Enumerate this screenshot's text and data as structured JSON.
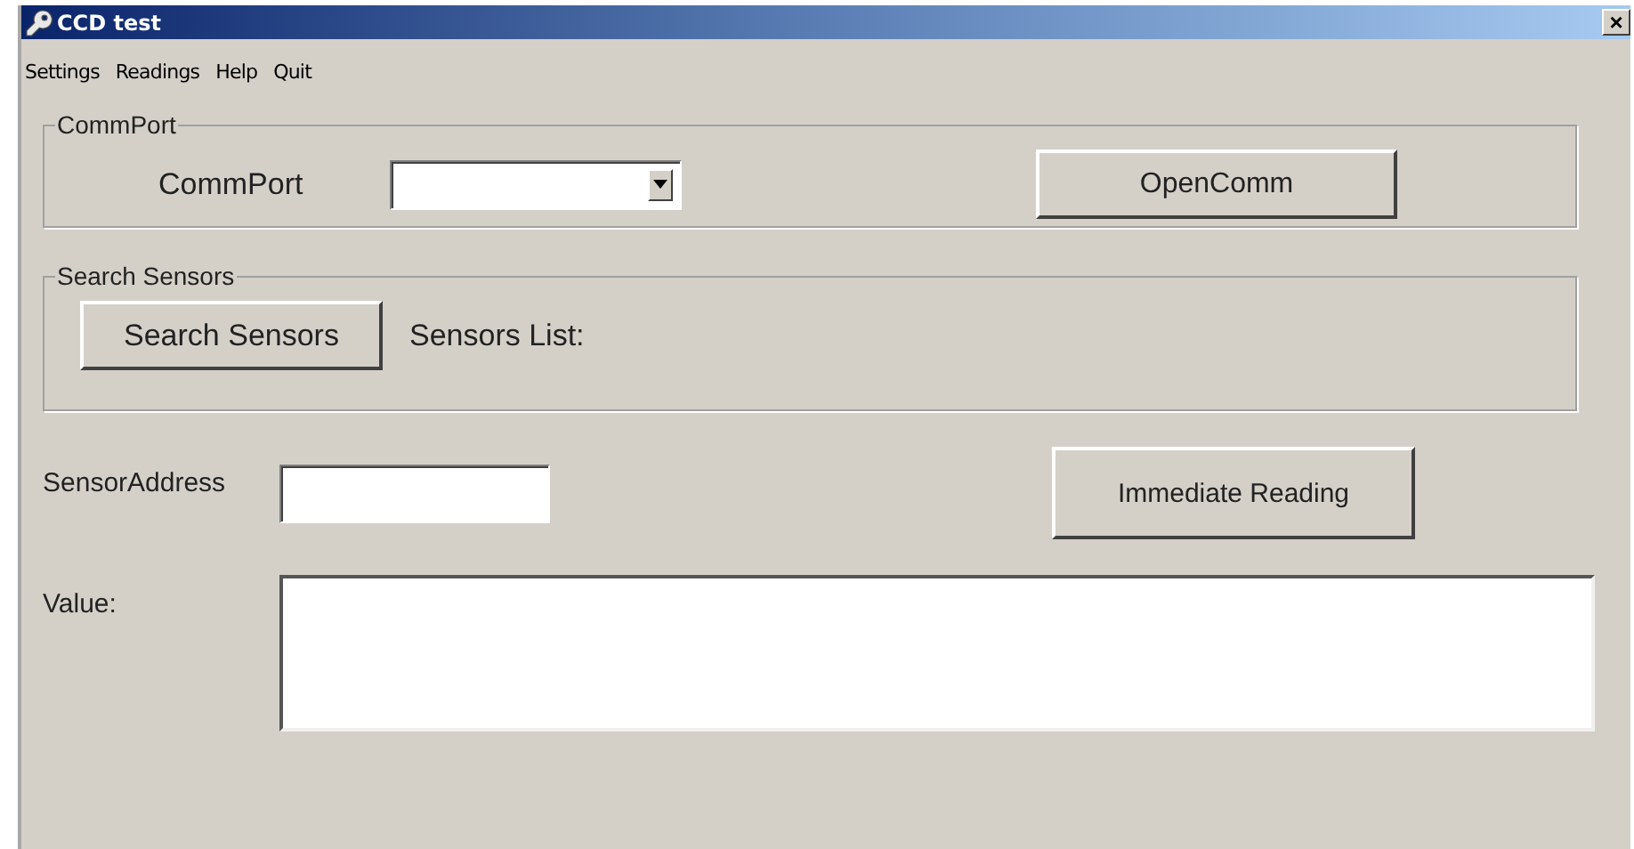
{
  "window": {
    "title": "CCD test",
    "close": "×"
  },
  "menu": [
    "Settings",
    "Readings",
    "Help",
    "Quit"
  ],
  "commport_group": {
    "legend": "CommPort",
    "label": "CommPort",
    "open_button": "OpenComm"
  },
  "search_group": {
    "legend": "Search Sensors",
    "search_button": "Search Sensors",
    "list_label": "Sensors List:"
  },
  "address": {
    "label": "SensorAddress",
    "reading_button": "Immediate Reading"
  },
  "value": {
    "label": "Value:"
  }
}
